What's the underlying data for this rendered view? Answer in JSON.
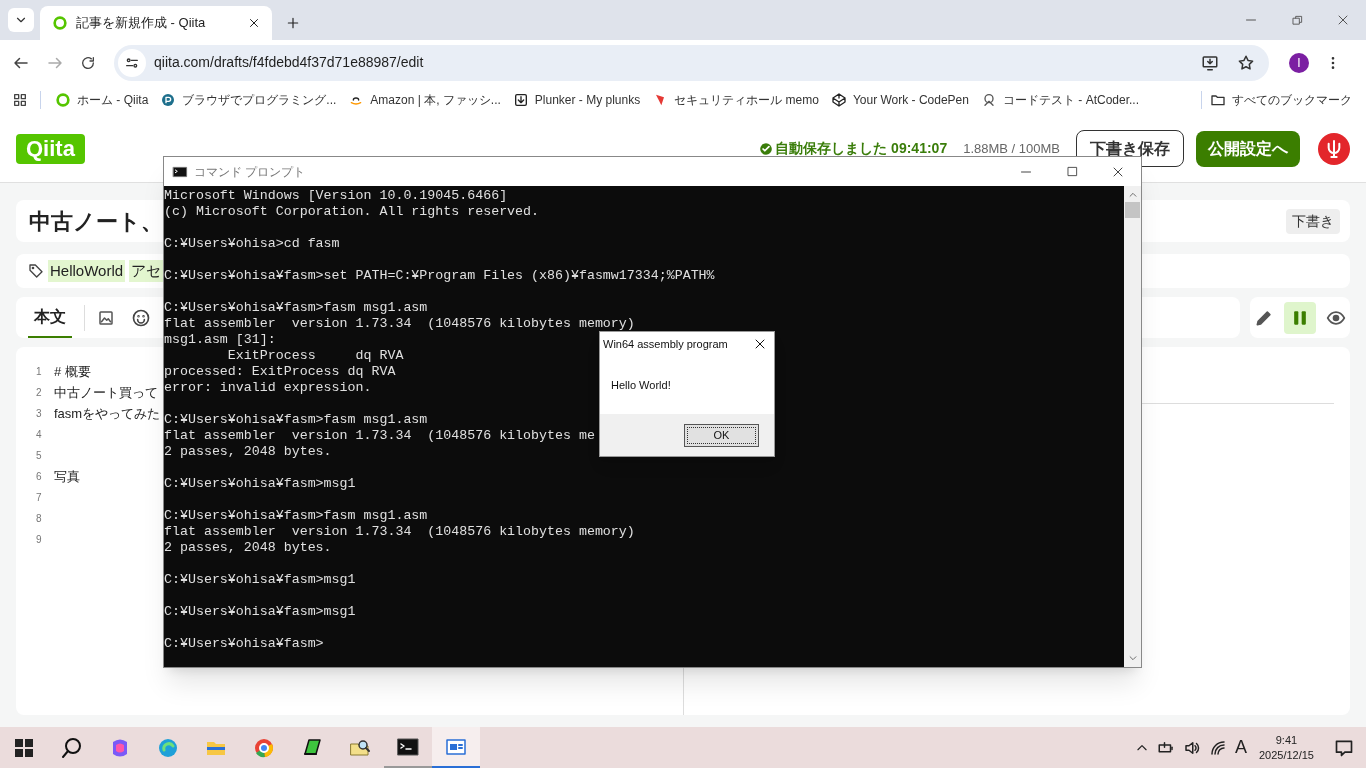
{
  "browser": {
    "tab": {
      "title": "記事を新規作成 - Qiita"
    },
    "address": "qiita.com/drafts/f4fdebd4f37d71e88987/edit",
    "avatar": "I",
    "bookmarks": [
      "ホーム - Qiita",
      "ブラウザでプログラミング...",
      "Amazon | 本, ファッシ...",
      "Plunker - My plunks",
      "セキュリティホール memo",
      "Your Work - CodePen",
      "コードテスト - AtCoder..."
    ],
    "all_bookmarks": "すべてのブックマーク"
  },
  "page": {
    "logo": "Qiita",
    "autosave": "自動保存しました 09:41:07",
    "storage": "1.88MB / 100MB",
    "save_draft": "下書き保存",
    "publish": "公開設定へ",
    "title": "中古ノート、",
    "status_badge": "下書き",
    "tags": [
      "HelloWorld",
      "アセ"
    ],
    "editor_tab": {
      "label": "本文",
      "selected": true
    },
    "view_modes": [
      {
        "kind": "edit",
        "selected": false
      },
      {
        "kind": "split",
        "selected": true
      },
      {
        "kind": "preview",
        "selected": false
      }
    ],
    "lines": [
      {
        "number": "1",
        "text": "# 概要"
      },
      {
        "number": "2",
        "text": "中古ノート買って"
      },
      {
        "number": "3",
        "text": "fasmをやってみた"
      },
      {
        "number": "4"
      },
      {
        "number": "5"
      },
      {
        "number": "6",
        "text": "写真"
      },
      {
        "number": "7"
      },
      {
        "number": "8"
      },
      {
        "number": "9"
      }
    ]
  },
  "console": {
    "title": "コマンド プロンプト",
    "blocks": [
      [
        "Microsoft Windows [Version 10.0.19045.6466]",
        "(c) Microsoft Corporation. All rights reserved."
      ],
      [
        "C:¥Users¥ohisa>cd fasm"
      ],
      [
        "C:¥Users¥ohisa¥fasm>set PATH=C:¥Program Files (x86)¥fasmw17334;%PATH%"
      ],
      [
        "C:¥Users¥ohisa¥fasm>fasm msg1.asm",
        "flat assembler  version 1.73.34  (1048576 kilobytes memory)",
        "msg1.asm [31]:",
        "        ExitProcess     dq RVA",
        "processed: ExitProcess dq RVA",
        "error: invalid expression."
      ],
      [
        "C:¥Users¥ohisa¥fasm>fasm msg1.asm",
        "flat assembler  version 1.73.34  (1048576 kilobytes me",
        "2 passes, 2048 bytes."
      ],
      [
        "C:¥Users¥ohisa¥fasm>msg1"
      ],
      [
        "C:¥Users¥ohisa¥fasm>fasm msg1.asm",
        "flat assembler  version 1.73.34  (1048576 kilobytes memory)",
        "2 passes, 2048 bytes."
      ],
      [
        "C:¥Users¥ohisa¥fasm>msg1"
      ],
      [
        "C:¥Users¥ohisa¥fasm>msg1"
      ],
      [
        "C:¥Users¥ohisa¥fasm>"
      ]
    ]
  },
  "dialog": {
    "title": "Win64 assembly program",
    "message": "Hello World!",
    "button": "OK"
  },
  "taskbar": {
    "ime": "A",
    "time": "9:41",
    "date": "2025/12/15"
  }
}
